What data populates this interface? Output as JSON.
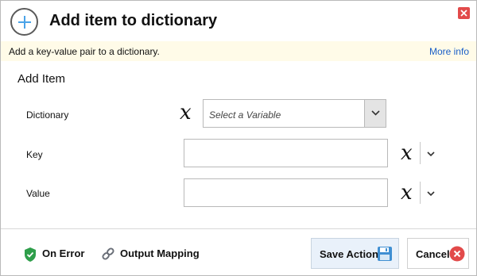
{
  "header": {
    "title": "Add item to dictionary",
    "icon": "plus-circle-icon",
    "close_icon": "close-icon"
  },
  "description": {
    "text": "Add a key-value pair to a dictionary.",
    "more_info": "More info"
  },
  "section": {
    "title": "Add Item"
  },
  "fields": {
    "dictionary": {
      "label": "Dictionary",
      "placeholder": "Select a Variable",
      "variable_icon": "x",
      "dropdown_icon": "chevron-down-icon"
    },
    "key": {
      "label": "Key",
      "value": "",
      "variable_icon": "x",
      "dropdown_icon": "chevron-down-icon"
    },
    "value": {
      "label": "Value",
      "value": "",
      "variable_icon": "x",
      "dropdown_icon": "chevron-down-icon"
    }
  },
  "footer": {
    "on_error": "On Error",
    "output_mapping": "Output Mapping",
    "save": "Save Action",
    "cancel": "Cancel"
  },
  "colors": {
    "accent": "#1a5fc7",
    "description_bg": "#fffbe8",
    "close": "#e24a4a",
    "shield": "#2e9e4a",
    "save_bg": "#e9f1fa"
  }
}
